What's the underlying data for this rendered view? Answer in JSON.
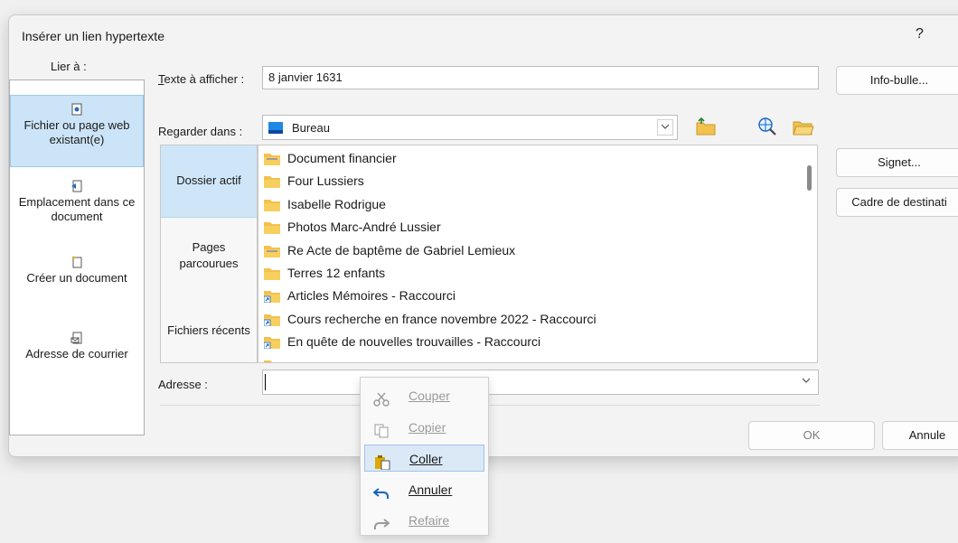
{
  "window": {
    "title": "Insérer un lien hypertexte",
    "help": "?"
  },
  "link_to": {
    "label": "Lier à :",
    "items": [
      {
        "label": "Fichier ou page web existant(e)",
        "icon": "file-page-icon",
        "selected": true
      },
      {
        "label": "Emplacement dans ce document",
        "icon": "document-location-icon",
        "selected": false
      },
      {
        "label": "Créer un document",
        "icon": "new-document-icon",
        "selected": false
      },
      {
        "label": "Adresse de courrier",
        "icon": "email-address-icon",
        "selected": false
      }
    ]
  },
  "text_to_display": {
    "label": "Texte à afficher :",
    "value": "8 janvier 1631"
  },
  "look_in": {
    "label": "Regarder dans :",
    "value": "Bureau"
  },
  "subnav": [
    {
      "label": "Dossier actif",
      "selected": true
    },
    {
      "label": "Pages parcourues",
      "selected": false
    },
    {
      "label": "Fichiers récents",
      "selected": false
    }
  ],
  "files": [
    {
      "name": "Document financier",
      "icon": "shared-folder-icon"
    },
    {
      "name": "Four Lussiers",
      "icon": "folder-icon"
    },
    {
      "name": "Isabelle Rodrigue",
      "icon": "folder-icon"
    },
    {
      "name": "Photos Marc-André Lussier",
      "icon": "folder-icon"
    },
    {
      "name": "Re Acte de baptême de Gabriel Lemieux",
      "icon": "shared-folder-icon"
    },
    {
      "name": "Terres 12 enfants",
      "icon": "folder-icon"
    },
    {
      "name": "Articles Mémoires - Raccourci",
      "icon": "shortcut-folder-icon"
    },
    {
      "name": "Cours recherche en france novembre 2022 - Raccourci",
      "icon": "shortcut-folder-icon"
    },
    {
      "name": "En quête de nouvelles trouvailles - Raccourci",
      "icon": "shortcut-folder-icon"
    },
    {
      "name": "",
      "icon": "shortcut-folder-icon"
    }
  ],
  "address": {
    "label": "Adresse :",
    "value": ""
  },
  "buttons": {
    "tooltip": "Info-bulle...",
    "bookmark": "Signet...",
    "target_frame": "Cadre de destinati",
    "ok": "OK",
    "cancel": "Annule"
  },
  "context_menu": [
    {
      "label": "Couper",
      "icon": "scissors-icon",
      "enabled": false,
      "highlighted": false
    },
    {
      "label": "Copier",
      "icon": "copy-icon",
      "enabled": false,
      "highlighted": false
    },
    {
      "label": "Coller",
      "icon": "paste-icon",
      "enabled": true,
      "highlighted": true
    },
    {
      "label": "Annuler",
      "icon": "undo-icon",
      "enabled": true,
      "highlighted": false
    },
    {
      "label": "Refaire",
      "icon": "redo-icon",
      "enabled": false,
      "highlighted": false
    }
  ],
  "colors": {
    "folder": "#f2c14e",
    "selection": "#cce4f7",
    "accent": "#1f6fc4"
  }
}
